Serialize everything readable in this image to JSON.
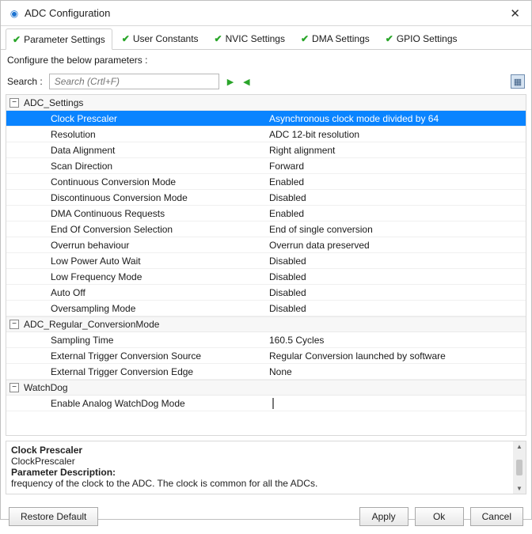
{
  "window": {
    "title": "ADC Configuration"
  },
  "tabs": [
    {
      "label": "Parameter Settings"
    },
    {
      "label": "User Constants"
    },
    {
      "label": "NVIC Settings"
    },
    {
      "label": "DMA Settings"
    },
    {
      "label": "GPIO Settings"
    }
  ],
  "subhead": "Configure the below parameters :",
  "search": {
    "label": "Search :",
    "placeholder": "Search (Crtl+F)"
  },
  "groups": [
    {
      "name": "ADC_Settings",
      "rows": [
        {
          "label": "Clock Prescaler",
          "value": "Asynchronous clock mode divided by 64",
          "selected": true
        },
        {
          "label": "Resolution",
          "value": "ADC 12-bit resolution"
        },
        {
          "label": "Data Alignment",
          "value": "Right alignment"
        },
        {
          "label": "Scan Direction",
          "value": "Forward"
        },
        {
          "label": "Continuous Conversion Mode",
          "value": "Enabled"
        },
        {
          "label": "Discontinuous Conversion Mode",
          "value": "Disabled"
        },
        {
          "label": "DMA Continuous Requests",
          "value": "Enabled"
        },
        {
          "label": "End Of Conversion Selection",
          "value": "End of single conversion"
        },
        {
          "label": "Overrun behaviour",
          "value": "Overrun data preserved"
        },
        {
          "label": "Low Power Auto Wait",
          "value": "Disabled"
        },
        {
          "label": "Low Frequency Mode",
          "value": "Disabled"
        },
        {
          "label": "Auto Off",
          "value": "Disabled"
        },
        {
          "label": "Oversampling Mode",
          "value": "Disabled"
        }
      ]
    },
    {
      "name": "ADC_Regular_ConversionMode",
      "rows": [
        {
          "label": "Sampling Time",
          "value": "160.5 Cycles"
        },
        {
          "label": "External Trigger Conversion Source",
          "value": "Regular Conversion launched by software"
        },
        {
          "label": "External Trigger Conversion Edge",
          "value": "None"
        }
      ]
    },
    {
      "name": "WatchDog",
      "rows": [
        {
          "label": "Enable Analog WatchDog Mode",
          "value": "",
          "checkbox": true
        }
      ]
    }
  ],
  "description": {
    "title": "Clock Prescaler",
    "subtitle": "ClockPrescaler",
    "heading": "Parameter Description:",
    "body": "frequency of the clock to the ADC. The clock is common for all the ADCs."
  },
  "buttons": {
    "restore": "Restore Default",
    "apply": "Apply",
    "ok": "Ok",
    "cancel": "Cancel"
  }
}
